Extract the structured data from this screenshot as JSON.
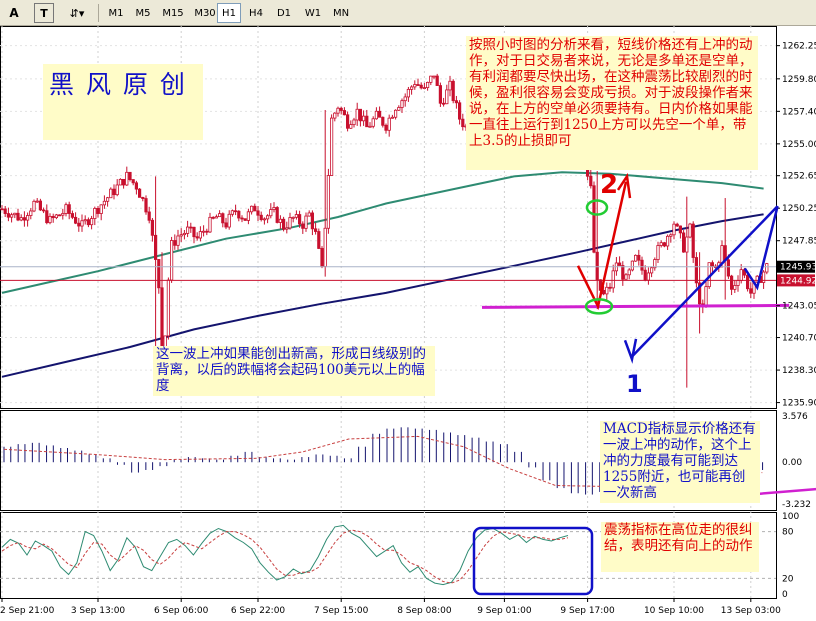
{
  "toolbar": {
    "tools": [
      {
        "icon": "text-tool-icon",
        "glyph": "A"
      },
      {
        "icon": "label-tool-icon",
        "glyph": "T"
      },
      {
        "icon": "arrows-tool-icon",
        "glyph": "⇵▾"
      }
    ],
    "timeframes": [
      "M1",
      "M5",
      "M15",
      "M30",
      "H1",
      "H4",
      "D1",
      "W1",
      "MN"
    ],
    "active_timeframe": "H1"
  },
  "colors": {
    "candle": "#c8102e",
    "ma_fast": "#2e8b72",
    "ma_slow": "#14146e",
    "bid_line": "#c8102e",
    "ask_line": "#aab4c8",
    "support": "#d020d0",
    "annotation_blue": "#1010c8",
    "annotation_red": "#e00000",
    "note_bg": "#fffcc8",
    "green_circle": "#22cc33"
  },
  "watermark": "黑  风  原  创",
  "notes": {
    "top_right": "按照小时图的分析来看，短线价格还有上冲的动作，对于日交易者来说，无论是多单还是空单，有利润都要尽快出场，在这种震荡比较剧烈的时候，盈利很容易会变成亏损。对于波段操作者来说，在上方的空单必须要持有。日内价格如果能一直往上运行到1250上方可以先空一个单，带上3.5的止损即可",
    "middle": "这一波上冲如果能创出新高，形成日线级别的背离，以后的跌幅将会起码100美元以上的幅度",
    "macd": "MACD指标显示价格还有一波上冲的动作，这个上冲的力度最有可能到达1255附近，也可能再创一次新高",
    "stoch": "震荡指标在高位走的很纠结，表明还有向上的动作",
    "wave2": "2",
    "wave1": "1"
  },
  "chart_data": [
    {
      "type": "candlestick",
      "title": "",
      "ylim": [
        1235.5,
        1263.7
      ],
      "y_ticks": [
        "1262.25",
        "1259.80",
        "1257.40",
        "1255.00",
        "1252.65",
        "1250.25",
        "1247.85",
        "1245.93",
        "1244.92",
        "1243.05",
        "1240.70",
        "1238.30",
        "1235.90"
      ],
      "bid_price": "1245.93",
      "ask_price": "1244.92",
      "bid_value": 1245.93,
      "ask_value": 1244.92,
      "support_level": 1243.0,
      "x_labels": [
        "2 Sep 21:00",
        "3 Sep 13:00",
        "6 Sep 06:00",
        "6 Sep 22:00",
        "7 Sep 15:00",
        "8 Sep 08:00",
        "9 Sep 01:00",
        "9 Sep 17:00",
        "10 Sep 10:00",
        "13 Sep 03:00"
      ],
      "close_path": [
        [
          0,
          1250.2
        ],
        [
          6,
          1249.5
        ],
        [
          10,
          1250.6
        ],
        [
          15,
          1249.3
        ],
        [
          20,
          1250.1
        ],
        [
          25,
          1248.9
        ],
        [
          30,
          1250.3
        ],
        [
          34,
          1251.3
        ],
        [
          39,
          1252.6
        ],
        [
          42,
          1251.9
        ],
        [
          46,
          1249.8
        ],
        [
          49,
          1244.5
        ],
        [
          50,
          1240.2
        ],
        [
          51,
          1241.0
        ],
        [
          52,
          1245.0
        ],
        [
          53,
          1247.5
        ],
        [
          55,
          1248.2
        ],
        [
          58,
          1248.6
        ],
        [
          61,
          1248.0
        ],
        [
          64,
          1248.9
        ],
        [
          67,
          1249.6
        ],
        [
          70,
          1249.1
        ],
        [
          73,
          1250.1
        ],
        [
          76,
          1249.5
        ],
        [
          79,
          1250.3
        ],
        [
          82,
          1249.6
        ],
        [
          85,
          1249.9
        ],
        [
          88,
          1248.9
        ],
        [
          91,
          1249.5
        ],
        [
          94,
          1249.1
        ],
        [
          96,
          1249.8
        ],
        [
          98,
          1248.3
        ],
        [
          100,
          1245.6
        ],
        [
          101,
          1249.0
        ],
        [
          102,
          1252.8
        ],
        [
          103,
          1256.8
        ],
        [
          105,
          1257.8
        ],
        [
          108,
          1256.6
        ],
        [
          111,
          1257.4
        ],
        [
          114,
          1256.2
        ],
        [
          117,
          1257.0
        ],
        [
          120,
          1256.4
        ],
        [
          123,
          1257.8
        ],
        [
          126,
          1258.5
        ],
        [
          129,
          1259.6
        ],
        [
          132,
          1258.9
        ],
        [
          135,
          1260.2
        ],
        [
          137,
          1258.0
        ],
        [
          140,
          1259.2
        ],
        [
          143,
          1256.9
        ],
        [
          146,
          1255.9
        ],
        [
          149,
          1256.8
        ],
        [
          152,
          1255.6
        ],
        [
          155,
          1256.4
        ],
        [
          158,
          1255.5
        ],
        [
          161,
          1256.6
        ],
        [
          164,
          1255.2
        ],
        [
          167,
          1256.1
        ],
        [
          170,
          1254.8
        ],
        [
          173,
          1255.9
        ],
        [
          176,
          1255.2
        ],
        [
          179,
          1254.0
        ],
        [
          182,
          1253.6
        ],
        [
          184,
          1251.6
        ],
        [
          185,
          1247.0
        ],
        [
          186,
          1244.6
        ],
        [
          188,
          1243.8
        ],
        [
          190,
          1244.5
        ],
        [
          192,
          1246.3
        ],
        [
          195,
          1244.9
        ],
        [
          198,
          1246.5
        ],
        [
          201,
          1245.3
        ],
        [
          204,
          1246.8
        ],
        [
          207,
          1247.8
        ],
        [
          210,
          1249.2
        ],
        [
          213,
          1247.4
        ],
        [
          215,
          1248.7
        ],
        [
          217,
          1244.5
        ],
        [
          219,
          1242.6
        ],
        [
          221,
          1246.0
        ],
        [
          223,
          1245.8
        ],
        [
          225,
          1247.3
        ],
        [
          228,
          1244.2
        ],
        [
          231,
          1245.8
        ],
        [
          234,
          1244.0
        ],
        [
          237,
          1245.2
        ],
        [
          239,
          1245.93
        ]
      ],
      "spikes": [
        {
          "bar": 48,
          "high": 1252.6,
          "low": 1239.5
        },
        {
          "bar": 50,
          "high": 1247.0,
          "low": 1238.8
        },
        {
          "bar": 101,
          "high": 1257.5,
          "low": 1245.2
        },
        {
          "bar": 186,
          "high": 1253.0,
          "low": 1242.8
        },
        {
          "bar": 214,
          "high": 1251.1,
          "low": 1237.0
        },
        {
          "bar": 218,
          "high": 1247.0,
          "low": 1241.0
        },
        {
          "bar": 226,
          "high": 1251.0,
          "low": 1243.5
        }
      ],
      "series": [
        {
          "points": [
            [
              0,
              1244.0
            ],
            [
              15,
              1244.8
            ],
            [
              30,
              1245.6
            ],
            [
              50,
              1246.8
            ],
            [
              70,
              1248.0
            ],
            [
              90,
              1248.8
            ],
            [
              105,
              1249.6
            ],
            [
              120,
              1250.6
            ],
            [
              140,
              1251.6
            ],
            [
              160,
              1252.6
            ],
            [
              175,
              1252.9
            ],
            [
              190,
              1252.8
            ],
            [
              210,
              1252.4
            ],
            [
              225,
              1252.1
            ],
            [
              238,
              1251.7
            ]
          ]
        },
        {
          "points": [
            [
              0,
              1237.8
            ],
            [
              20,
              1238.9
            ],
            [
              40,
              1240.0
            ],
            [
              60,
              1241.3
            ],
            [
              80,
              1242.3
            ],
            [
              100,
              1243.2
            ],
            [
              120,
              1244.0
            ],
            [
              140,
              1245.0
            ],
            [
              160,
              1246.0
            ],
            [
              180,
              1247.0
            ],
            [
              195,
              1247.8
            ],
            [
              210,
              1248.6
            ],
            [
              225,
              1249.3
            ],
            [
              238,
              1249.8
            ]
          ]
        }
      ]
    },
    {
      "type": "bar",
      "title": "",
      "y_ticks": [
        "3.576",
        "0.00",
        "-3.232"
      ],
      "ylim": [
        -3.232,
        3.576
      ],
      "bar_values": [
        1.2,
        1.4,
        1.5,
        1.3,
        1.1,
        0.9,
        0.6,
        0.3,
        -0.2,
        -0.8,
        -0.6,
        -0.3,
        0.2,
        0.4,
        0.3,
        0.2,
        0.5,
        0.8,
        0.4,
        0.3,
        0.2,
        0.4,
        0.6,
        0.5,
        0.3,
        1.2,
        2.2,
        2.6,
        2.7,
        2.6,
        2.5,
        2.3,
        2.1,
        1.9,
        1.6,
        1.4,
        0.8,
        -0.4,
        -1.4,
        -2.0,
        -2.4,
        -2.5,
        -2.3,
        -2.1,
        -1.9,
        -1.7,
        -1.4,
        -1.2,
        -1.4,
        -1.6,
        -1.3,
        -1.1,
        -0.9,
        -0.6
      ],
      "signal": [
        [
          0,
          1.0
        ],
        [
          8,
          0.6
        ],
        [
          14,
          0.2
        ],
        [
          22,
          0.3
        ],
        [
          26,
          0.8
        ],
        [
          30,
          1.8
        ],
        [
          36,
          2.0
        ],
        [
          40,
          1.2
        ],
        [
          44,
          -0.5
        ],
        [
          48,
          -1.8
        ],
        [
          54,
          -1.9
        ],
        [
          60,
          -1.3
        ],
        [
          66,
          -0.8
        ]
      ],
      "divergence_line": [
        [
          47,
          -3.0
        ],
        [
          66,
          -1.3
        ]
      ]
    },
    {
      "type": "line",
      "title": "",
      "y_ticks": [
        "100",
        "80",
        "20",
        "0"
      ],
      "ylim": [
        0,
        100
      ],
      "series": [
        {
          "values": [
            60,
            70,
            65,
            50,
            68,
            62,
            55,
            35,
            25,
            40,
            80,
            75,
            55,
            30,
            45,
            72,
            60,
            35,
            30,
            48,
            66,
            70,
            62,
            50,
            65,
            78,
            84,
            80,
            72,
            66,
            58,
            40,
            28,
            18,
            22,
            32,
            26,
            30,
            48,
            70,
            86,
            88,
            78,
            72,
            60,
            48,
            55,
            62,
            40,
            28,
            35,
            20,
            14,
            12,
            15,
            30,
            55,
            72,
            82,
            84,
            78,
            70,
            76,
            66,
            74,
            70,
            68,
            72,
            75
          ]
        },
        {
          "values": [
            55,
            62,
            66,
            60,
            58,
            64,
            58,
            48,
            38,
            34,
            52,
            66,
            64,
            50,
            42,
            52,
            62,
            56,
            44,
            38,
            46,
            58,
            66,
            62,
            58,
            66,
            74,
            80,
            80,
            76,
            70,
            60,
            46,
            32,
            24,
            24,
            28,
            28,
            34,
            50,
            66,
            78,
            82,
            80,
            74,
            64,
            56,
            56,
            50,
            40,
            36,
            30,
            22,
            16,
            14,
            18,
            30,
            46,
            62,
            74,
            80,
            78,
            76,
            72,
            72,
            72,
            70,
            70,
            72
          ]
        }
      ]
    }
  ]
}
